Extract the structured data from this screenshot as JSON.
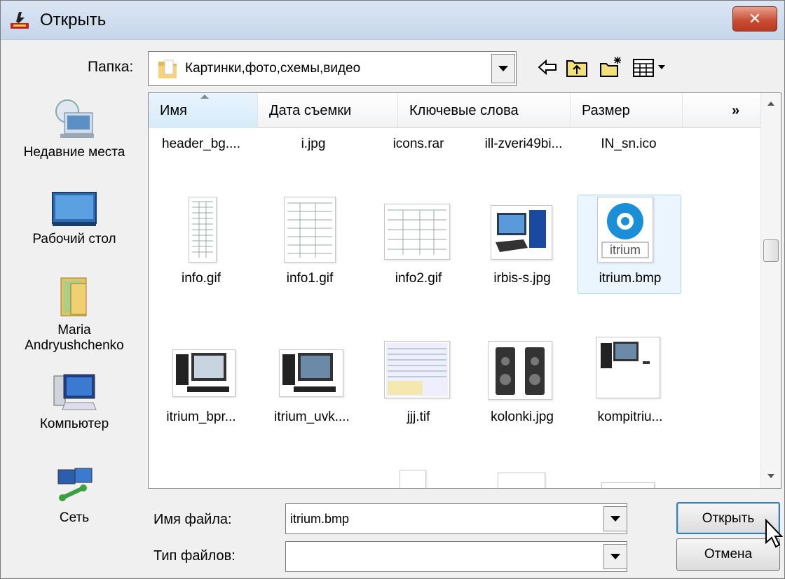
{
  "window": {
    "title": "Открыть",
    "close_label": "✕"
  },
  "folder": {
    "label": "Папка:",
    "current": "Картинки,фото,схемы,видео"
  },
  "toolbar": {
    "icons": [
      "back-icon",
      "up-folder-icon",
      "new-folder-icon",
      "view-menu-icon"
    ]
  },
  "places": [
    {
      "label": "Недавние места"
    },
    {
      "label": "Рабочий стол"
    },
    {
      "label": "Maria Andryushchenko"
    },
    {
      "label": "Компьютер"
    },
    {
      "label": "Сеть"
    }
  ],
  "columns": [
    "Имя",
    "Дата съемки",
    "Ключевые слова",
    "Размер",
    "»"
  ],
  "files": {
    "row1": [
      "header_bg....",
      "i.jpg",
      "icons.rar",
      "ill-zveri49bi...",
      "IN_sn.ico"
    ],
    "row2": [
      "info.gif",
      "info1.gif",
      "info2.gif",
      "irbis-s.jpg",
      "itrium.bmp"
    ],
    "row3": [
      "itrium_bpr...",
      "itrium_uvk....",
      "jjj.tif",
      "kolonki.jpg",
      "kompitriu..."
    ]
  },
  "thumb_text": {
    "itrium_logo": "itrium"
  },
  "selected_file": "itrium.bmp",
  "filename": {
    "label": "Имя файла:",
    "value": "itrium.bmp"
  },
  "filetype": {
    "label": "Тип файлов:",
    "value": ""
  },
  "buttons": {
    "open": "Открыть",
    "cancel": "Отмена"
  }
}
